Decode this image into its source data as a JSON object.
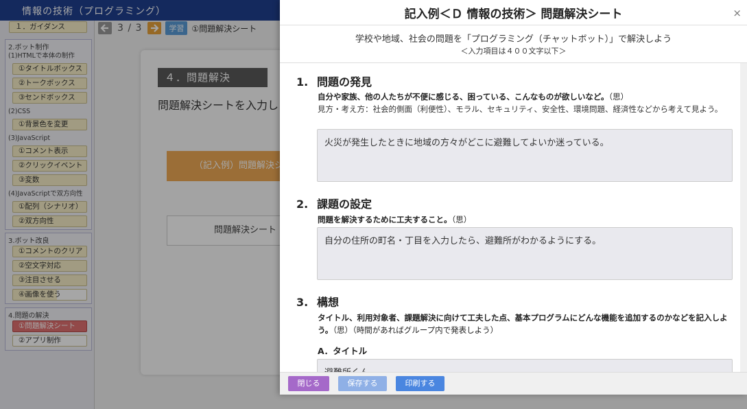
{
  "app": {
    "title": "情報の技術（プログラミング）"
  },
  "sidebar": {
    "groups": [
      {
        "title": "",
        "items": [
          "１．ガイダンス"
        ]
      },
      {
        "title": "2.ボット制作",
        "sub1": "(1)HTMLで本体の制作",
        "items1": [
          "①タイトルボックス",
          "②トークボックス",
          "③センドボックス"
        ],
        "sub2": "(2)CSS",
        "items2": [
          "①背景色を変更"
        ],
        "sub3": "(3)JavaScript",
        "items3": [
          "①コメント表示",
          "②クリックイベント",
          "③変数"
        ],
        "sub4": "(4)JavaScriptで双方向性",
        "items4": [
          "①配列（シナリオ）",
          "②双方向性"
        ]
      },
      {
        "title": "3.ボット改良",
        "items": [
          "①コメントのクリア",
          "②空文字対応",
          "③注目させる",
          "④画像を使う"
        ]
      },
      {
        "title": "4.問題の解決",
        "items": [
          "①問題解決シート",
          "②アプリ制作"
        ]
      }
    ]
  },
  "breadcrumb": {
    "page": "3 / 3",
    "badge": "学習",
    "title": "①問題解決シート"
  },
  "main": {
    "section_title": "４．問題解決",
    "intro": "問題解決シートを入力し",
    "example_button": "（記入例）問題解決シ",
    "sheet_button": "問題解決シート"
  },
  "modal": {
    "title": "記入例＜Ｄ 情報の技術＞ 問題解決シート",
    "close_symbol": "×",
    "subtitle": "学校や地域、社会の問題を「プログラミング（チャットボット）」で解決しよう",
    "note": "＜入力項目は４００文字以下＞",
    "sections": [
      {
        "num": "1.",
        "heading": "問題の発見",
        "prompt": "自分や家族、他の人たちが不便に感じる、困っている、こんなものが欲しいなど。",
        "prompt_tag": "（思）",
        "hint": "見方・考え方：社会的側面（利便性）、モラル、セキュリティ、安全性、環境問題、経済性などから考えて見よう。",
        "answer": "火災が発生したときに地域の方々がどこに避難してよいか迷っている。"
      },
      {
        "num": "2.",
        "heading": "課題の設定",
        "prompt": "問題を解決するために工夫すること。",
        "prompt_tag": "（思）",
        "answer": "自分の住所の町名・丁目を入力したら、避難所がわかるようにする。"
      },
      {
        "num": "3.",
        "heading": "構想",
        "prompt": "タイトル、利用対象者、課題解決に向けて工夫した点、基本プログラムにどんな機能を追加するのかなどを記入しよう。",
        "prompt_tag": "（思）（時間があればグループ内で発表しよう）",
        "sub_heading": "A．タイトル",
        "answer": "避難所くん"
      }
    ],
    "footer": {
      "close": "閉じる",
      "save": "保存する",
      "print": "印刷する"
    }
  }
}
